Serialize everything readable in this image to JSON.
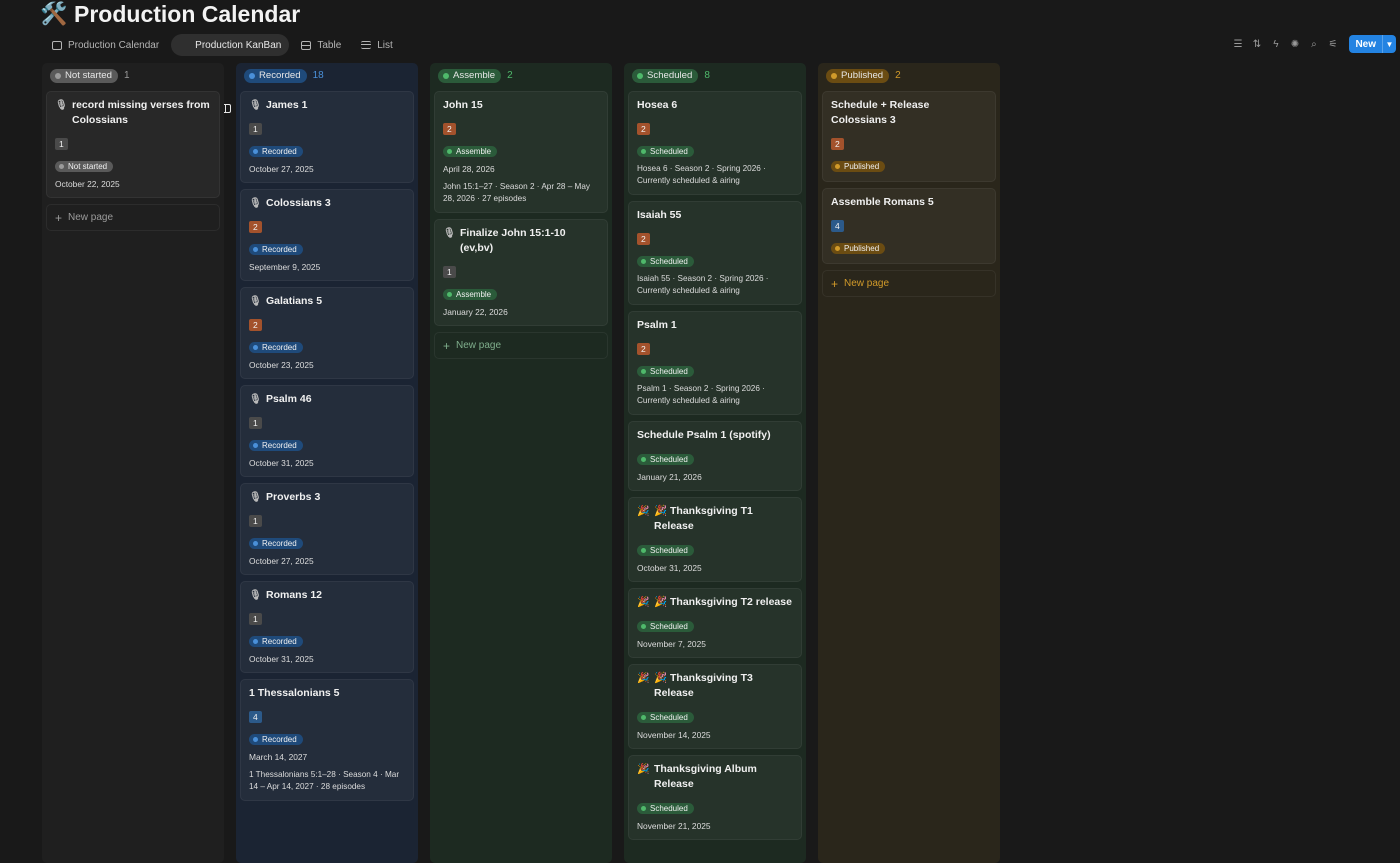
{
  "page": {
    "title": "Production Calendar",
    "icon": "🛠️"
  },
  "tabs": [
    {
      "label": "Production Calendar",
      "icon": "calendar-icon"
    },
    {
      "label": "Production KanBan",
      "icon": "board-icon"
    },
    {
      "label": "Table",
      "icon": "table-icon"
    },
    {
      "label": "List",
      "icon": "list-icon"
    }
  ],
  "toolbar": {
    "new_label": "New"
  },
  "new_page_label": "New page",
  "colors": {
    "not_started": "#5a5a5a",
    "not_started_dot": "#9b9b9b",
    "not_started_bg": "#1f1f1f",
    "recorded": "#1f4a7a",
    "recorded_dot": "#4a90d9",
    "recorded_bg": "#1b2433",
    "assemble": "#2b5b3a",
    "assemble_dot": "#4fb96b",
    "assemble_bg": "#1d2a21",
    "scheduled": "#2b5b3a",
    "scheduled_dot": "#4fb96b",
    "scheduled_bg": "#1d2a21",
    "published": "#6b4c12",
    "published_dot": "#d19a2a",
    "published_bg": "#2a261b",
    "tag_orange": "#a3522c",
    "tag_gray": "#4a4a4a",
    "tag_blue": "#2c5a8a"
  },
  "columns": {
    "not_started": {
      "status": "Not started",
      "count": "1",
      "cards": [
        {
          "title": "record missing verses from Colossians",
          "tag": "1",
          "status": "Not started",
          "date": "October 22, 2025"
        }
      ]
    },
    "recorded": {
      "status": "Recorded",
      "count": "18",
      "cards": [
        {
          "title": "James 1",
          "tag": "1",
          "status": "Recorded",
          "date": "October 27, 2025"
        },
        {
          "title": "Colossians 3",
          "tag": "2",
          "status": "Recorded",
          "date": "September 9, 2025"
        },
        {
          "title": "Galatians 5",
          "tag": "2",
          "status": "Recorded",
          "date": "October 23, 2025"
        },
        {
          "title": "Psalm 46",
          "tag": "1",
          "status": "Recorded",
          "date": "October 31, 2025"
        },
        {
          "title": "Proverbs 3",
          "tag": "1",
          "status": "Recorded",
          "date": "October 27, 2025"
        },
        {
          "title": "Romans 12",
          "tag": "1",
          "status": "Recorded",
          "date": "October 31, 2025"
        },
        {
          "title": "1 Thessalonians 5",
          "tag": "4",
          "status": "Recorded",
          "date": "March 14, 2027",
          "desc": "1 Thessalonians 5:1–28 · Season 4 · Mar 14 – Apr 14, 2027 · 28 episodes"
        }
      ]
    },
    "assemble": {
      "status": "Assemble",
      "count": "2",
      "cards": [
        {
          "title": "John 15",
          "tag": "2",
          "status": "Assemble",
          "date": "April 28, 2026",
          "desc": "John 15:1–27 · Season 2 · Apr 28 – May 28, 2026 · 27 episodes"
        },
        {
          "title": "Finalize John 15:1-10 (ev,bv)",
          "tag": "1",
          "status": "Assemble",
          "date": "January 22, 2026"
        }
      ]
    },
    "scheduled": {
      "status": "Scheduled",
      "count": "8",
      "cards": [
        {
          "title": "Hosea 6",
          "tag": "2",
          "status": "Scheduled",
          "desc": "Hosea 6 · Season 2 · Spring 2026 · Currently scheduled & airing"
        },
        {
          "title": "Isaiah 55",
          "tag": "2",
          "status": "Scheduled",
          "desc": "Isaiah 55 · Season 2 · Spring 2026 · Currently scheduled & airing"
        },
        {
          "title": "Psalm 1",
          "tag": "2",
          "status": "Scheduled",
          "desc": "Psalm 1 · Season 2 · Spring 2026 · Currently scheduled & airing"
        },
        {
          "title": "Schedule Psalm 1 (spotify)",
          "status": "Scheduled",
          "date": "January 21, 2026"
        },
        {
          "title": "🎉 Thanksgiving T1 Release",
          "status": "Scheduled",
          "date": "October 31, 2025"
        },
        {
          "title": "🎉 Thanksgiving T2 release",
          "status": "Scheduled",
          "date": "November 7, 2025"
        },
        {
          "title": "🎉 Thanksgiving T3 Release",
          "status": "Scheduled",
          "date": "November 14, 2025"
        },
        {
          "title": "Thanksgiving Album Release",
          "status": "Scheduled",
          "date": "November 21, 2025"
        }
      ]
    },
    "published": {
      "status": "Published",
      "count": "2",
      "cards": [
        {
          "title": "Schedule + Release Colossians 3",
          "tag": "2",
          "status": "Published"
        },
        {
          "title": "Assemble Romans 5",
          "tag": "4",
          "status": "Published"
        }
      ]
    }
  }
}
